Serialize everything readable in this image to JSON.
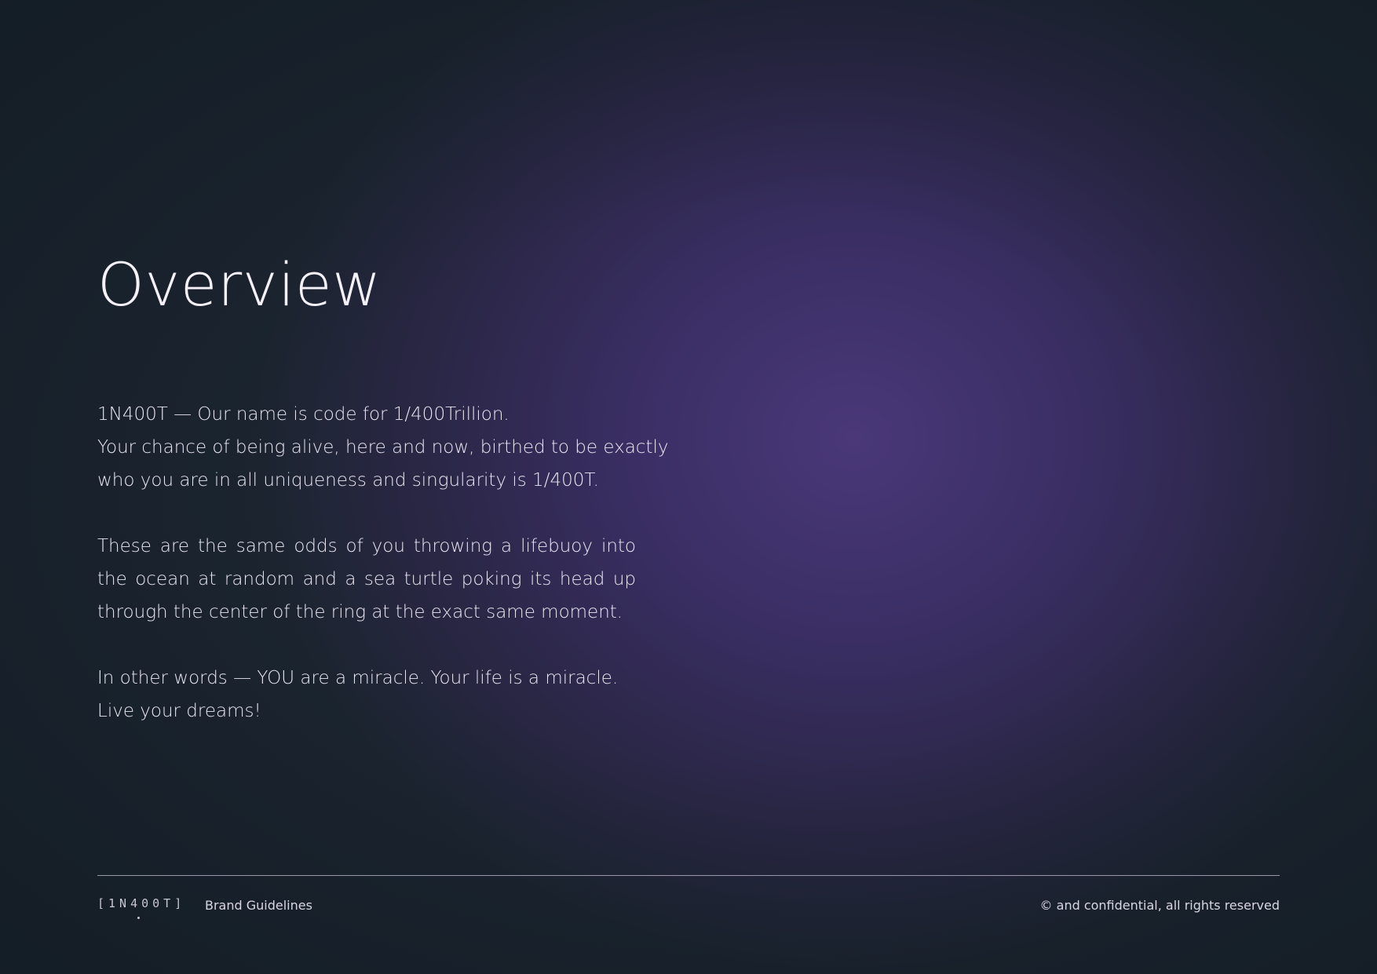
{
  "page": {
    "title": "Overview"
  },
  "body": {
    "p1": {
      "line1": "1N400T — Our name is code for 1/400Trillion.",
      "line2": "Your chance of being alive, here and now, birthed to be exactly",
      "line3": "who you are in all uniqueness and singularity is 1/400T."
    },
    "p2": {
      "text": "These are the same odds of you throwing a lifebuoy into the ocean at random and a sea turtle poking its head up through the center of the ring at the exact same moment."
    },
    "p3": {
      "line1": "In other words — YOU are a miracle. Your life is a miracle.",
      "line2": "Live your dreams!"
    }
  },
  "footer": {
    "logo": "[1N400T]",
    "label": "Brand Guidelines",
    "copyright": "© and confidential, all rights reserved"
  },
  "colors": {
    "background_center": "#4a3878",
    "background_edge": "#1c2530",
    "text": "#e9e6f1"
  }
}
